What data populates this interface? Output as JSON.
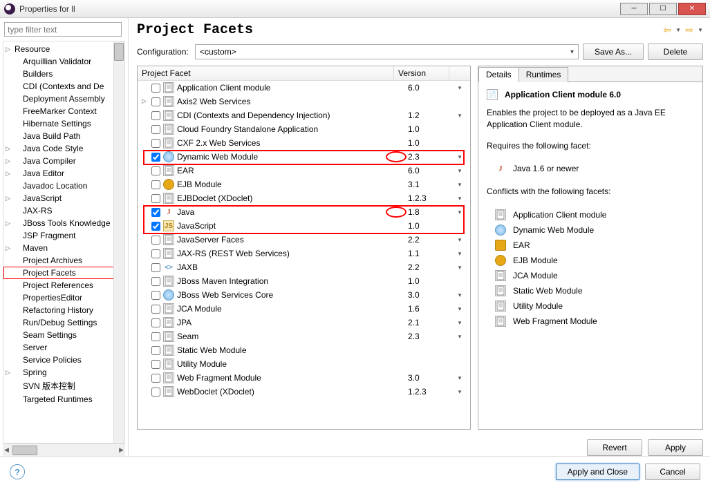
{
  "window": {
    "title": "Properties for ll"
  },
  "sidebar": {
    "filter_placeholder": "type filter text",
    "items": [
      {
        "label": "Resource",
        "parent": true
      },
      {
        "label": "Arquillian Validator",
        "child": true
      },
      {
        "label": "Builders",
        "child": true
      },
      {
        "label": "CDI (Contexts and De",
        "child": true
      },
      {
        "label": "Deployment Assembly",
        "child": true
      },
      {
        "label": "FreeMarker Context",
        "child": true
      },
      {
        "label": "Hibernate Settings",
        "child": true
      },
      {
        "label": "Java Build Path",
        "child": true
      },
      {
        "label": "Java Code Style",
        "parent": true,
        "child": true
      },
      {
        "label": "Java Compiler",
        "parent": true,
        "child": true
      },
      {
        "label": "Java Editor",
        "parent": true,
        "child": true
      },
      {
        "label": "Javadoc Location",
        "child": true
      },
      {
        "label": "JavaScript",
        "parent": true,
        "child": true
      },
      {
        "label": "JAX-RS",
        "child": true
      },
      {
        "label": "JBoss Tools Knowledge",
        "parent": true,
        "child": true
      },
      {
        "label": "JSP Fragment",
        "child": true
      },
      {
        "label": "Maven",
        "parent": true,
        "child": true
      },
      {
        "label": "Project Archives",
        "child": true
      },
      {
        "label": "Project Facets",
        "child": true,
        "selected": true
      },
      {
        "label": "Project References",
        "child": true
      },
      {
        "label": "PropertiesEditor",
        "child": true
      },
      {
        "label": "Refactoring History",
        "child": true
      },
      {
        "label": "Run/Debug Settings",
        "child": true
      },
      {
        "label": "Seam Settings",
        "child": true
      },
      {
        "label": "Server",
        "child": true
      },
      {
        "label": "Service Policies",
        "child": true
      },
      {
        "label": "Spring",
        "parent": true,
        "child": true
      },
      {
        "label": "SVN 版本控制",
        "child": true
      },
      {
        "label": "Targeted Runtimes",
        "child": true
      }
    ]
  },
  "header": {
    "title": "Project Facets"
  },
  "config": {
    "label": "Configuration:",
    "value": "<custom>",
    "save_as": "Save As...",
    "delete": "Delete"
  },
  "facets": {
    "cols": {
      "name": "Project Facet",
      "version": "Version"
    },
    "rows": [
      {
        "checked": false,
        "icon": "file",
        "name": "Application Client module",
        "version": "6.0",
        "drop": true
      },
      {
        "checked": false,
        "exp": true,
        "icon": "file",
        "name": "Axis2 Web Services",
        "version": "",
        "drop": false
      },
      {
        "checked": false,
        "icon": "file",
        "name": "CDI (Contexts and Dependency Injection)",
        "version": "1.2",
        "drop": true
      },
      {
        "checked": false,
        "icon": "file",
        "name": "Cloud Foundry Standalone Application",
        "version": "1.0",
        "drop": false
      },
      {
        "checked": false,
        "icon": "file",
        "name": "CXF 2.x Web Services",
        "version": "1.0",
        "drop": false
      },
      {
        "checked": true,
        "icon": "globe",
        "name": "Dynamic Web Module",
        "version": "2.3",
        "drop": true,
        "hl": true,
        "circ": true
      },
      {
        "checked": false,
        "icon": "file",
        "name": "EAR",
        "version": "6.0",
        "drop": true
      },
      {
        "checked": false,
        "icon": "ejb",
        "name": "EJB Module",
        "version": "3.1",
        "drop": true
      },
      {
        "checked": false,
        "icon": "file",
        "name": "EJBDoclet (XDoclet)",
        "version": "1.2.3",
        "drop": true
      },
      {
        "checked": true,
        "icon": "java",
        "name": "Java",
        "version": "1.8",
        "drop": true,
        "hl": "start",
        "circ": true
      },
      {
        "checked": true,
        "icon": "js",
        "name": "JavaScript",
        "version": "1.0",
        "drop": false,
        "hl": "end"
      },
      {
        "checked": false,
        "icon": "file",
        "name": "JavaServer Faces",
        "version": "2.2",
        "drop": true
      },
      {
        "checked": false,
        "icon": "file",
        "name": "JAX-RS (REST Web Services)",
        "version": "1.1",
        "drop": true
      },
      {
        "checked": false,
        "icon": "angle",
        "name": "JAXB",
        "version": "2.2",
        "drop": true
      },
      {
        "checked": false,
        "icon": "file",
        "name": "JBoss Maven Integration",
        "version": "1.0",
        "drop": false
      },
      {
        "checked": false,
        "icon": "globe",
        "name": "JBoss Web Services Core",
        "version": "3.0",
        "drop": true
      },
      {
        "checked": false,
        "icon": "file",
        "name": "JCA Module",
        "version": "1.6",
        "drop": true
      },
      {
        "checked": false,
        "icon": "file",
        "name": "JPA",
        "version": "2.1",
        "drop": true
      },
      {
        "checked": false,
        "icon": "file",
        "name": "Seam",
        "version": "2.3",
        "drop": true
      },
      {
        "checked": false,
        "icon": "file",
        "name": "Static Web Module",
        "version": "",
        "drop": false
      },
      {
        "checked": false,
        "icon": "file",
        "name": "Utility Module",
        "version": "",
        "drop": false
      },
      {
        "checked": false,
        "icon": "file",
        "name": "Web Fragment Module",
        "version": "3.0",
        "drop": true
      },
      {
        "checked": false,
        "icon": "file",
        "name": "WebDoclet (XDoclet)",
        "version": "1.2.3",
        "drop": true
      }
    ]
  },
  "details": {
    "tabs": {
      "details": "Details",
      "runtimes": "Runtimes"
    },
    "title": "Application Client module 6.0",
    "desc": "Enables the project to be deployed as a Java EE Application Client module.",
    "requires_label": "Requires the following facet:",
    "requires": [
      {
        "icon": "java",
        "label": "Java 1.6 or newer"
      }
    ],
    "conflicts_label": "Conflicts with the following facets:",
    "conflicts": [
      {
        "icon": "file",
        "label": "Application Client module"
      },
      {
        "icon": "globe",
        "label": "Dynamic Web Module"
      },
      {
        "icon": "jar",
        "label": "EAR"
      },
      {
        "icon": "ejb",
        "label": "EJB Module"
      },
      {
        "icon": "file",
        "label": "JCA Module"
      },
      {
        "icon": "file",
        "label": "Static Web Module"
      },
      {
        "icon": "file",
        "label": "Utility Module"
      },
      {
        "icon": "file",
        "label": "Web Fragment Module"
      }
    ]
  },
  "buttons": {
    "revert": "Revert",
    "apply": "Apply",
    "apply_close": "Apply and Close",
    "cancel": "Cancel"
  }
}
